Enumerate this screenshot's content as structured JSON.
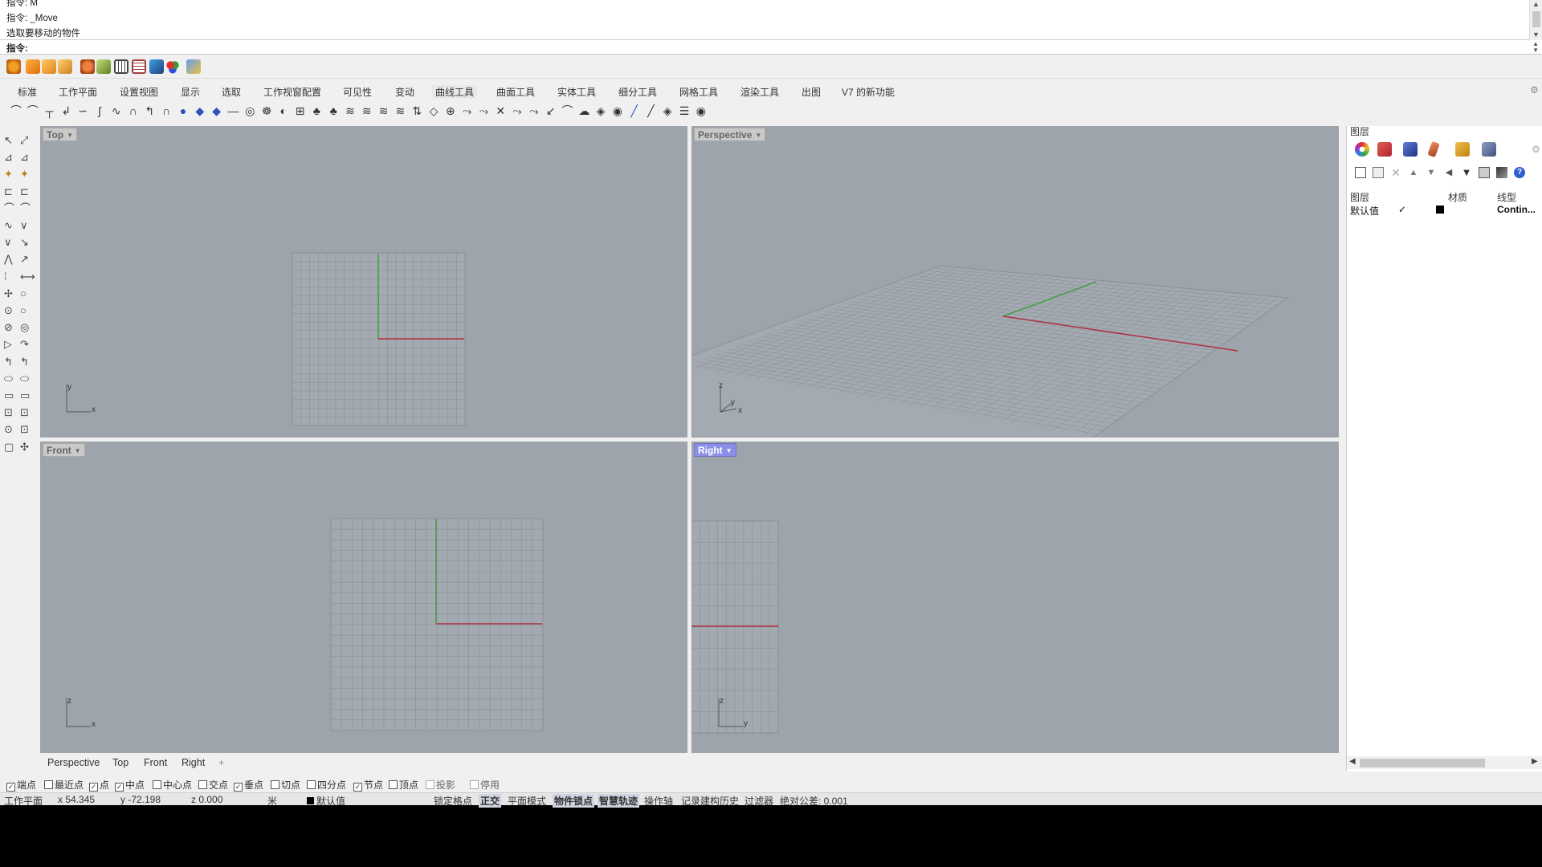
{
  "command_history": {
    "lines": [
      "指令: M",
      "指令: _Move",
      "选取要移动的物件"
    ]
  },
  "command_prompt": {
    "label": "指令:",
    "value": ""
  },
  "tabs": [
    {
      "label": "标准"
    },
    {
      "label": "工作平面"
    },
    {
      "label": "设置视图"
    },
    {
      "label": "显示"
    },
    {
      "label": "选取"
    },
    {
      "label": "工作视窗配置"
    },
    {
      "label": "可见性"
    },
    {
      "label": "变动"
    },
    {
      "label": "曲线工具",
      "active": true
    },
    {
      "label": "曲面工具"
    },
    {
      "label": "实体工具"
    },
    {
      "label": "细分工具"
    },
    {
      "label": "网格工具"
    },
    {
      "label": "渲染工具"
    },
    {
      "label": "出图"
    },
    {
      "label": "V7 的新功能"
    }
  ],
  "viewports": {
    "top": {
      "label": "Top"
    },
    "perspective": {
      "label": "Perspective"
    },
    "front": {
      "label": "Front"
    },
    "right": {
      "label": "Right",
      "active": true
    }
  },
  "axis_labels": {
    "top": {
      "v": "y",
      "h": "x"
    },
    "perspective": {
      "z": "z",
      "y": "y",
      "x": "x"
    },
    "front": {
      "v": "z",
      "h": "x"
    },
    "right": {
      "v": "z",
      "h": "y"
    }
  },
  "viewport_tabs": [
    "Perspective",
    "Top",
    "Front",
    "Right",
    "+"
  ],
  "osnaps": [
    {
      "label": "端点",
      "checked": true
    },
    {
      "label": "最近点",
      "checked": false
    },
    {
      "label": "点",
      "checked": true
    },
    {
      "label": "中点",
      "checked": true
    },
    {
      "label": "中心点",
      "checked": false
    },
    {
      "label": "交点",
      "checked": false
    },
    {
      "label": "垂点",
      "checked": true
    },
    {
      "label": "切点",
      "checked": false
    },
    {
      "label": "四分点",
      "checked": false
    },
    {
      "label": "节点",
      "checked": true
    },
    {
      "label": "顶点",
      "checked": false
    },
    {
      "label": "投影",
      "checked": false,
      "disabled": true
    },
    {
      "label": "停用",
      "checked": false,
      "disabled": true
    }
  ],
  "status": {
    "cplane": "工作平面",
    "x": "x 54.345",
    "y": "y -72.198",
    "z": "z 0.000",
    "unit": "米",
    "layer": "默认值",
    "grid_snap": "锁定格点",
    "ortho": "正交",
    "planar": "平面模式",
    "osnap": "物件锁点",
    "smarttrack": "智慧轨迹",
    "gumball": "操作轴",
    "history": "记录建构历史",
    "filter": "过滤器",
    "tolerance": "绝对公差: 0.001"
  },
  "layer_panel": {
    "title": "图层",
    "headers": {
      "layer": "图层",
      "material": "材质",
      "linetype": "线型"
    },
    "rows": [
      {
        "name": "默认值",
        "current": "✓",
        "color": "#000000",
        "linetype": "Contin..."
      }
    ]
  },
  "colors": {
    "viewport_bg": "#9ea4ab",
    "grid_line": "#8a9097",
    "x_axis": "#b03040",
    "y_axis": "#40a040",
    "active_viewport_tab": "#8c8fe8"
  }
}
